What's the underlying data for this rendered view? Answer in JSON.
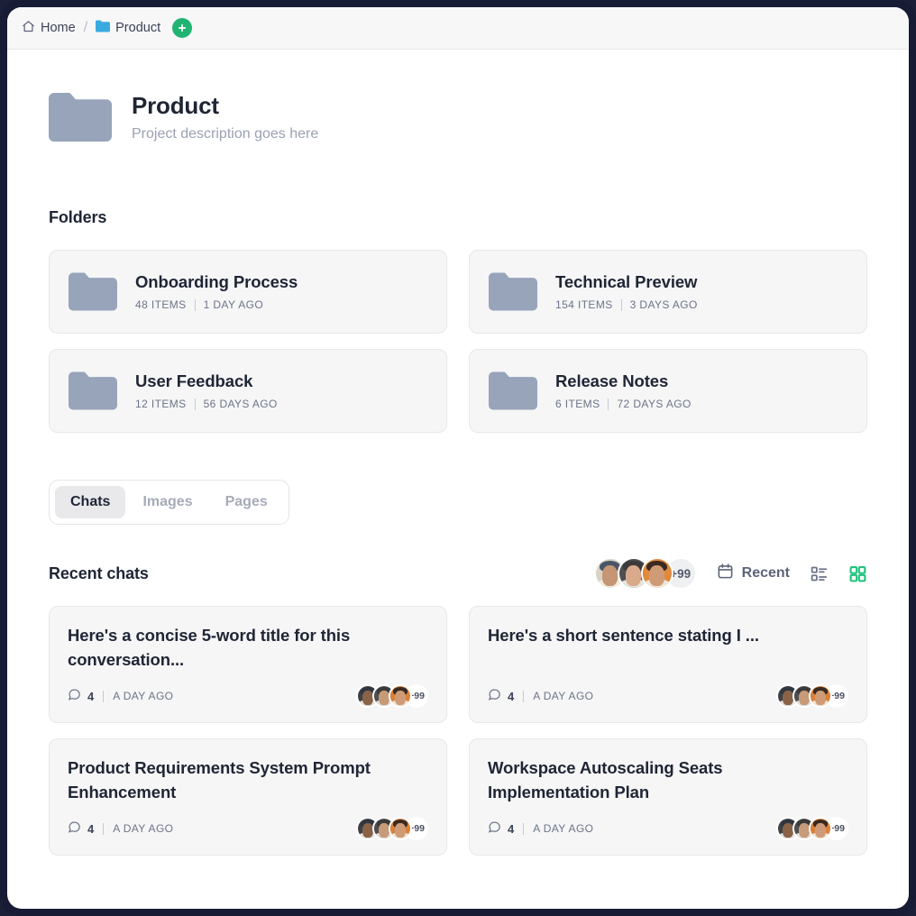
{
  "breadcrumb": {
    "home_label": "Home",
    "home_icon": "home-icon",
    "separator": "/",
    "current_label": "Product",
    "current_icon": "folder-icon-blue",
    "add_icon": "plus-icon",
    "accent_green": "#20b473",
    "folder_blue": "#3aa9e0"
  },
  "project": {
    "title": "Product",
    "description": "Project description goes here",
    "folder_color": "#98a4ba"
  },
  "folders_section": {
    "title": "Folders",
    "items": [
      {
        "name": "Onboarding Process",
        "items_label": "48 ITEMS",
        "time_label": "1 DAY AGO"
      },
      {
        "name": "Technical Preview",
        "items_label": "154 ITEMS",
        "time_label": "3 DAYS AGO"
      },
      {
        "name": "User Feedback",
        "items_label": "12 ITEMS",
        "time_label": "56 DAYS AGO"
      },
      {
        "name": "Release Notes",
        "items_label": "6 ITEMS",
        "time_label": "72 DAYS AGO"
      }
    ]
  },
  "tabs": {
    "items": [
      {
        "label": "Chats",
        "active": true
      },
      {
        "label": "Images",
        "active": false
      },
      {
        "label": "Pages",
        "active": false
      }
    ]
  },
  "chats_section": {
    "title": "Recent chats",
    "avatar_overflow": "+99",
    "sort_label": "Recent",
    "sort_icon": "calendar-icon",
    "list_view_icon": "list-view-icon",
    "grid_view_icon": "grid-view-icon",
    "grid_view_active_color": "#20c27c",
    "list_view_color": "#6d7488",
    "cards": [
      {
        "title": "Here's a concise 5-word title for this conversation...",
        "comment_count": "4",
        "time_label": "A DAY AGO",
        "avatar_overflow": "+99"
      },
      {
        "title": "Here's a short sentence stating I ...",
        "comment_count": "4",
        "time_label": "A DAY AGO",
        "avatar_overflow": "+99"
      },
      {
        "title": "Product Requirements System Prompt Enhancement",
        "comment_count": "4",
        "time_label": "A DAY AGO",
        "avatar_overflow": "+99"
      },
      {
        "title": "Workspace Autoscaling Seats Implementation Plan",
        "comment_count": "4",
        "time_label": "A DAY AGO",
        "avatar_overflow": "+99"
      }
    ]
  }
}
